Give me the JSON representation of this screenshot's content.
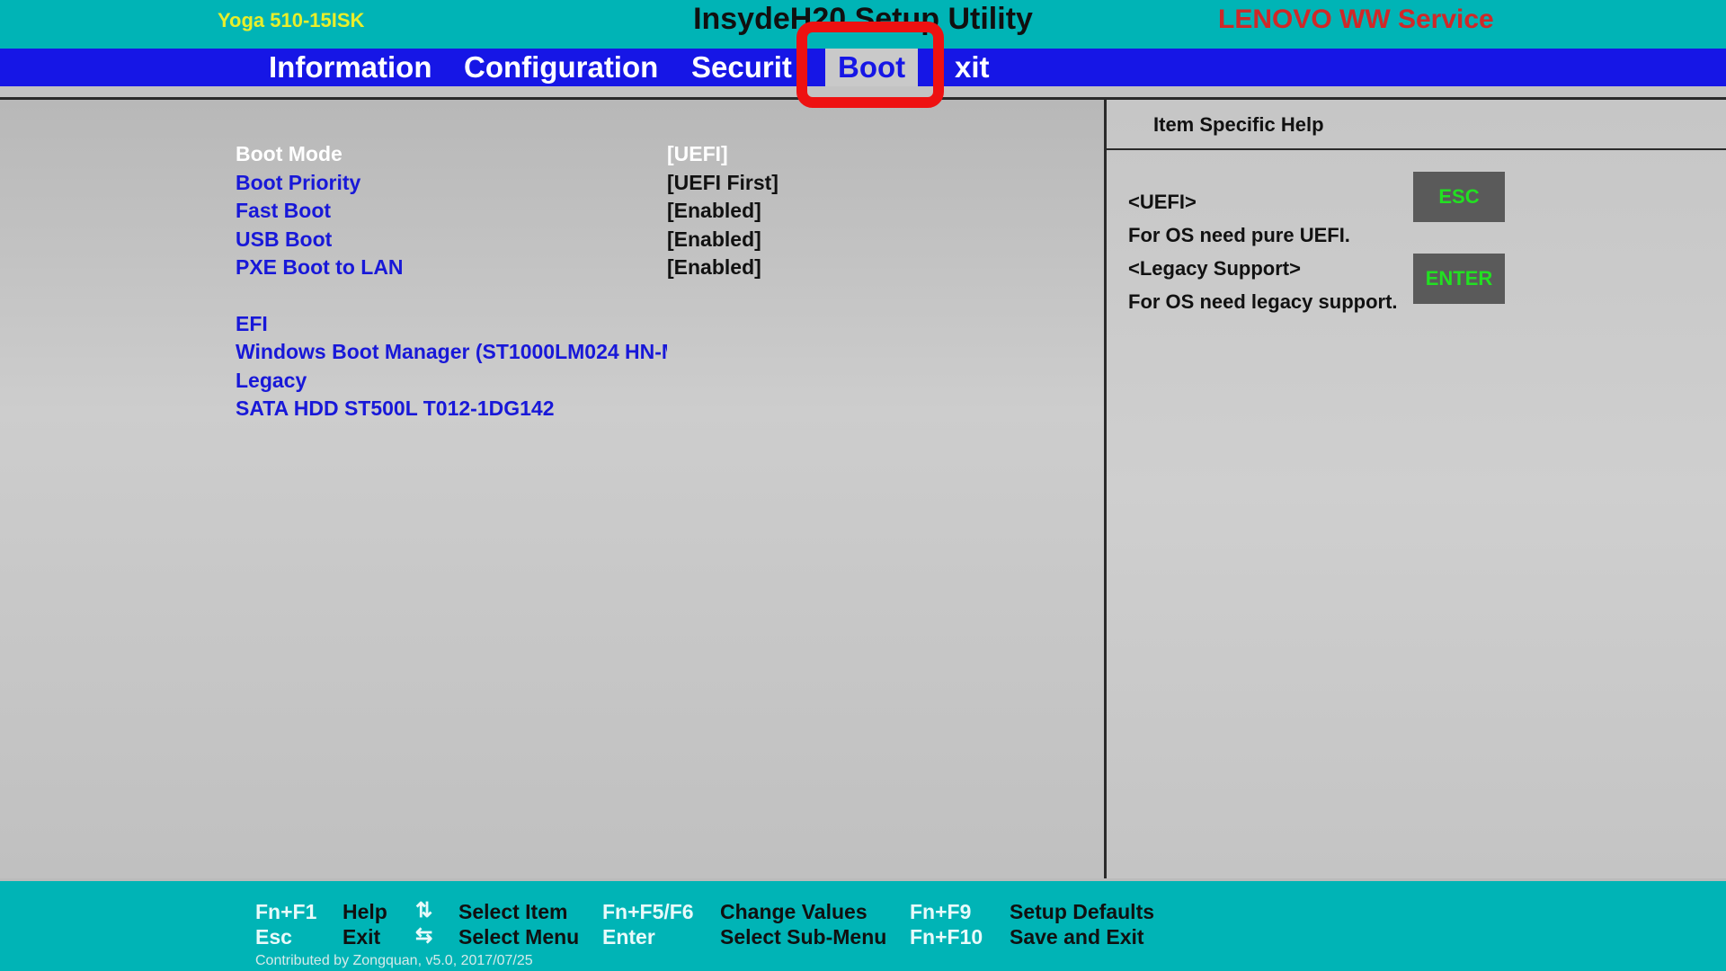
{
  "header": {
    "model": "Yoga 510-15ISK",
    "title": "InsydeH20 Setup Utility",
    "service": "LENOVO WW Service"
  },
  "menu": {
    "tabs": [
      "Information",
      "Configuration",
      "Securit",
      "Boot",
      "xit"
    ],
    "active": "Boot"
  },
  "boot_settings": [
    {
      "label": "Boot Mode",
      "value": "[UEFI]",
      "selected": true
    },
    {
      "label": "Boot Priority",
      "value": "[UEFI First]"
    },
    {
      "label": "Fast Boot",
      "value": "[Enabled]"
    },
    {
      "label": "USB Boot",
      "value": "[Enabled]"
    },
    {
      "label": "PXE Boot to LAN",
      "value": "[Enabled]"
    }
  ],
  "boot_devices": {
    "efi_heading": "EFI",
    "efi_device": "Windows Boot Manager (ST1000LM024 HN-M",
    "legacy_heading": "Legacy",
    "legacy_device": "SATA HDD  ST500L T012-1DG142"
  },
  "help": {
    "title": "Item Specific Help",
    "lines": [
      "<UEFI>",
      "For OS need pure UEFI.",
      "<Legacy Support>",
      "For OS need legacy support."
    ],
    "keys": [
      "ESC",
      "ENTER"
    ]
  },
  "footer": {
    "key1": "Fn+F1",
    "desc1": "Help",
    "key2": "Esc",
    "desc2": "Exit",
    "arrow_ud": "⇅",
    "desc3": "Select Item",
    "arrow_lr": "⇆",
    "desc4": "Select Menu",
    "key5": "Fn+F5/F6",
    "desc5": "Change Values",
    "key6": "Enter",
    "desc6": "Select Sub-Menu",
    "key7": "Fn+F9",
    "desc7": "Setup Defaults",
    "key8": "Fn+F10",
    "desc8": "Save and Exit",
    "credit": "Contributed by Zongquan, v5.0, 2017/07/25"
  },
  "colors": {
    "top_bar": "#00b4b6",
    "menu_bar": "#1616e6",
    "highlight_box": "#ee1111",
    "key_text": "#22e022"
  },
  "icons": {
    "arrow_up_down": "arrow-up-down-icon",
    "arrow_left_right": "arrow-left-right-icon"
  }
}
